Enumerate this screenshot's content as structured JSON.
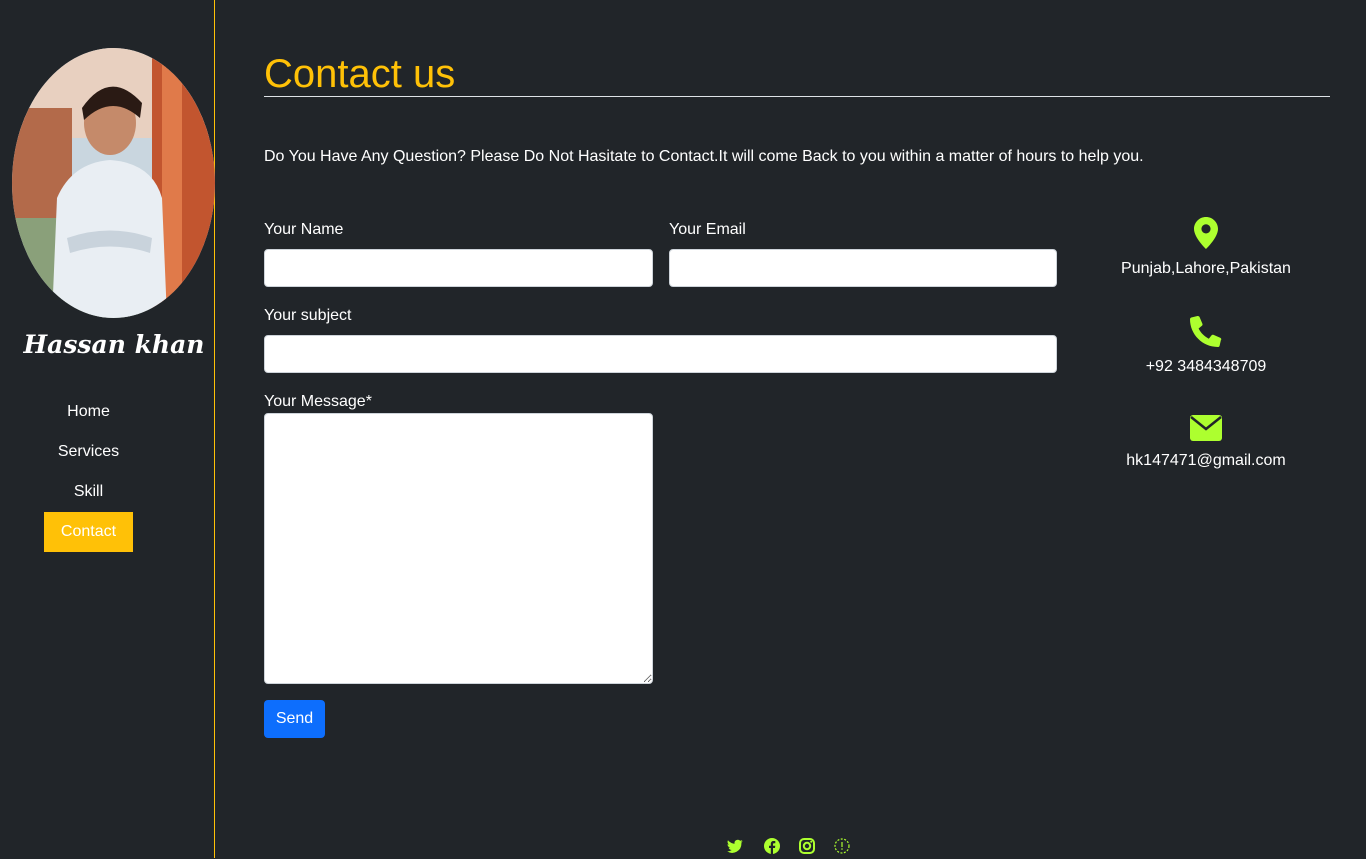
{
  "profile": {
    "name": "Hassan khan"
  },
  "nav": {
    "items": [
      {
        "label": "Home"
      },
      {
        "label": "Services"
      },
      {
        "label": "Skill"
      },
      {
        "label": "Contact",
        "active": true
      }
    ]
  },
  "main": {
    "title": "Contact us",
    "intro": "Do You Have Any Question? Please Do Not Hasitate to Contact.It will come Back to you within a matter of hours to help you.",
    "form": {
      "name_label": "Your Name",
      "name_value": "",
      "email_label": "Your Email",
      "email_value": "",
      "subject_label": "Your subject",
      "subject_value": "",
      "message_label": "Your Message*",
      "message_value": "",
      "send_label": "Send"
    },
    "contact_info": {
      "address": "Punjab,Lahore,Pakistan",
      "address_icon": "location-pin-icon",
      "phone": "+92 3484348709",
      "phone_icon": "phone-icon",
      "email": "hk147471@gmail.com",
      "email_icon": "envelope-icon"
    }
  },
  "footer": {
    "social_icons": [
      "twitter-icon",
      "facebook-icon",
      "instagram-icon",
      "dribbble-icon"
    ]
  },
  "colors": {
    "background": "#212529",
    "accent": "#ffc107",
    "icon": "#adff2f",
    "button": "#0d6efd"
  }
}
